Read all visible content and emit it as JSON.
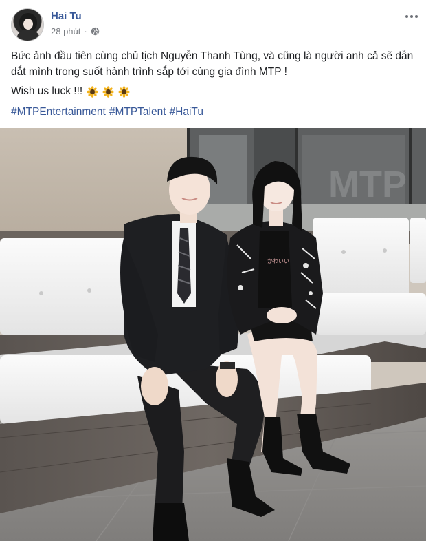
{
  "post": {
    "author": "Hai Tu",
    "time": "28 phút",
    "privacy_icon": "globe-icon",
    "more_icon": "more-options-icon",
    "text": "Bức ảnh đầu tiên cùng chủ tịch Nguyễn Thanh Tùng, và cũng là người anh cả sẽ dẫn dắt mình trong suốt hành trình sắp tới cùng gia đình MTP !",
    "line2": "Wish us luck !!!",
    "emoji_icon": "sunflower-icon",
    "hashtags": [
      "#MTPEntertainment",
      "#MTPTalent",
      "#HaiTu"
    ],
    "photo_text": "かわいい"
  },
  "colors": {
    "link": "#385898",
    "text": "#1c1e21",
    "meta": "#7a7d82"
  }
}
